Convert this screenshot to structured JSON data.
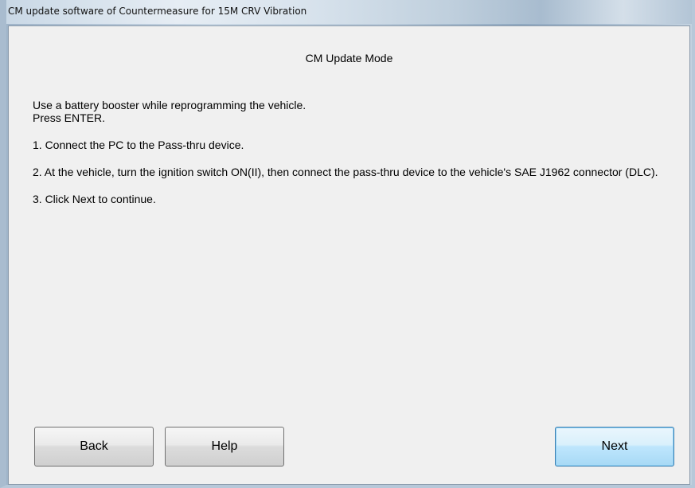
{
  "window": {
    "title": "CM update software of Countermeasure for 15M CRV Vibration"
  },
  "main": {
    "heading": "CM Update Mode",
    "instructions": {
      "line1": "Use a battery booster while reprogramming the vehicle.",
      "line2": "Press ENTER.",
      "step1": "1. Connect the PC to the  Pass-thru device.",
      "step2": "2. At the vehicle, turn the ignition switch ON(II), then connect the pass-thru device to the vehicle's SAE J1962 connector (DLC).",
      "step3": "3. Click Next to continue."
    }
  },
  "buttons": {
    "back": "Back",
    "help": "Help",
    "next": "Next"
  },
  "colors": {
    "next_accent": "#3c7fb1",
    "panel_bg": "#f0f0f0"
  }
}
